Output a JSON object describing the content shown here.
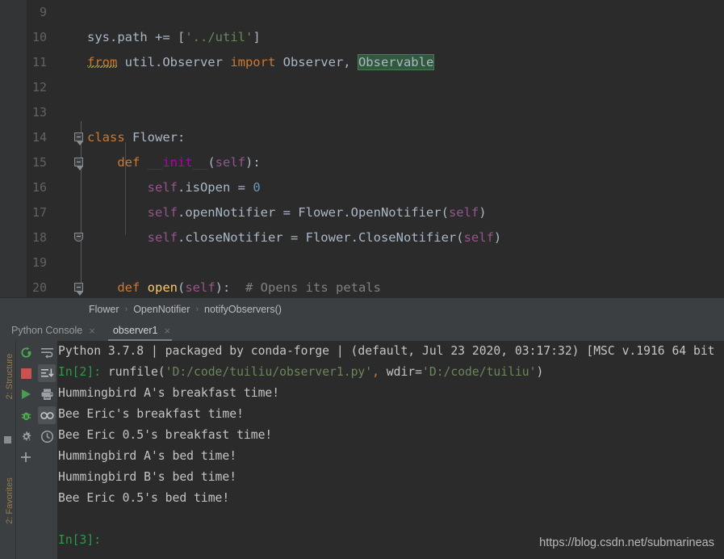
{
  "editor": {
    "first_visible_line": 9,
    "lines": [
      {
        "no": 9,
        "tokens": []
      },
      {
        "no": 10,
        "tokens": [
          {
            "t": "sys.path ",
            "c": "ident"
          },
          {
            "t": "+= ",
            "c": "op"
          },
          {
            "t": "[",
            "c": "ident"
          },
          {
            "t": "'../util'",
            "c": "str"
          },
          {
            "t": "]",
            "c": "ident"
          }
        ]
      },
      {
        "no": 11,
        "tokens": [
          {
            "t": "from",
            "c": "kw squiggle"
          },
          {
            "t": " util.Observer ",
            "c": "ident"
          },
          {
            "t": "import",
            "c": "kw"
          },
          {
            "t": " Observer, ",
            "c": "ident"
          },
          {
            "t": "Observable",
            "c": "hl-found"
          }
        ]
      },
      {
        "no": 12,
        "tokens": []
      },
      {
        "no": 13,
        "tokens": []
      },
      {
        "no": 14,
        "tokens": [
          {
            "t": "class",
            "c": "kw"
          },
          {
            "t": " Flower:",
            "c": "ident"
          }
        ]
      },
      {
        "no": 15,
        "tokens": [
          {
            "t": "    ",
            "c": "ident"
          },
          {
            "t": "def",
            "c": "kw-def"
          },
          {
            "t": " ",
            "c": "ident"
          },
          {
            "t": "__init__",
            "c": "magic"
          },
          {
            "t": "(",
            "c": "ident"
          },
          {
            "t": "self",
            "c": "self"
          },
          {
            "t": "):",
            "c": "ident"
          }
        ]
      },
      {
        "no": 16,
        "tokens": [
          {
            "t": "        ",
            "c": "ident"
          },
          {
            "t": "self",
            "c": "self"
          },
          {
            "t": ".isOpen = ",
            "c": "ident"
          },
          {
            "t": "0",
            "c": "num"
          }
        ]
      },
      {
        "no": 17,
        "tokens": [
          {
            "t": "        ",
            "c": "ident"
          },
          {
            "t": "self",
            "c": "self"
          },
          {
            "t": ".openNotifier = Flower.OpenNotifier(",
            "c": "ident"
          },
          {
            "t": "self",
            "c": "self"
          },
          {
            "t": ")",
            "c": "ident"
          }
        ]
      },
      {
        "no": 18,
        "tokens": [
          {
            "t": "        ",
            "c": "ident"
          },
          {
            "t": "self",
            "c": "self"
          },
          {
            "t": ".closeNotifier = Flower.CloseNotifier(",
            "c": "ident"
          },
          {
            "t": "self",
            "c": "self"
          },
          {
            "t": ")",
            "c": "ident"
          }
        ]
      },
      {
        "no": 19,
        "tokens": []
      },
      {
        "no": 20,
        "tokens": [
          {
            "t": "    ",
            "c": "ident"
          },
          {
            "t": "def",
            "c": "kw-def"
          },
          {
            "t": " ",
            "c": "ident"
          },
          {
            "t": "open",
            "c": "fn"
          },
          {
            "t": "(",
            "c": "ident"
          },
          {
            "t": "self",
            "c": "self"
          },
          {
            "t": "):  ",
            "c": "ident"
          },
          {
            "t": "# Opens its petals",
            "c": "comment"
          }
        ]
      }
    ],
    "highlight_color": "#32593d",
    "search_match_text": "Observable"
  },
  "breadcrumb": {
    "separator": "›",
    "items": [
      "Flower",
      "OpenNotifier",
      "notifyObservers()"
    ]
  },
  "tabs": {
    "close_glyph": "×",
    "items": [
      {
        "label": "Python Console",
        "active": false
      },
      {
        "label": "observer1",
        "active": true
      }
    ]
  },
  "rail": {
    "structure_label": "2: Structure",
    "favorites_label": "2: Favorites"
  },
  "run_toolbar": {
    "items": [
      {
        "name": "rerun-icon",
        "title": "Rerun"
      },
      {
        "name": "stop-icon",
        "title": "Stop"
      },
      {
        "name": "run-icon",
        "title": "Run"
      },
      {
        "name": "debug-icon",
        "title": "Debug"
      },
      {
        "name": "settings-icon",
        "title": "Settings"
      },
      {
        "name": "plus-icon",
        "title": "New"
      }
    ]
  },
  "console_toolbar": {
    "items": [
      {
        "name": "soft-wrap-icon",
        "selected": false
      },
      {
        "name": "scroll-to-end-icon",
        "selected": true
      },
      {
        "name": "print-icon",
        "selected": false
      },
      {
        "name": "infinity-icon",
        "selected": true
      },
      {
        "name": "history-clock-icon",
        "selected": false
      }
    ]
  },
  "console": {
    "lines": [
      {
        "segs": [
          {
            "t": "Python 3.7.8 | packaged by conda-forge | (default, Jul 23 2020, 03:17:32) [MSC v.1916 64 bit",
            "c": "c-txt"
          }
        ]
      },
      {
        "segs": [
          {
            "t": "In[2]: ",
            "c": "c-prompt"
          },
          {
            "t": "runfile(",
            "c": "c-txt"
          },
          {
            "t": "'D:/code/tuiliu/observer1.py'",
            "c": "c-str"
          },
          {
            "t": ",",
            "c": "c-op"
          },
          {
            "t": " wdir=",
            "c": "c-txt"
          },
          {
            "t": "'D:/code/tuiliu'",
            "c": "c-str"
          },
          {
            "t": ")",
            "c": "c-txt"
          }
        ]
      },
      {
        "segs": [
          {
            "t": "Hummingbird A's breakfast time!",
            "c": "c-txt"
          }
        ]
      },
      {
        "segs": [
          {
            "t": "Bee Eric's breakfast time!",
            "c": "c-txt"
          }
        ]
      },
      {
        "segs": [
          {
            "t": "Bee Eric 0.5's breakfast time!",
            "c": "c-txt"
          }
        ]
      },
      {
        "segs": [
          {
            "t": "Hummingbird A's bed time!",
            "c": "c-txt"
          }
        ]
      },
      {
        "segs": [
          {
            "t": "Hummingbird B's bed time!",
            "c": "c-txt"
          }
        ]
      },
      {
        "segs": [
          {
            "t": "Bee Eric 0.5's bed time!",
            "c": "c-txt"
          }
        ]
      },
      {
        "segs": []
      },
      {
        "segs": [
          {
            "t": "In[3]:",
            "c": "c-prompt"
          }
        ]
      }
    ]
  },
  "watermark": {
    "text": "https://blog.csdn.net/submarineas"
  },
  "colors": {
    "editor_bg": "#2b2b2b",
    "panel_bg": "#3c3f41",
    "gutter_bg": "#313335",
    "keyword": "#cc7832",
    "string": "#6a8759",
    "number": "#6897bb",
    "self": "#94558d",
    "function": "#ffc66d",
    "magic": "#b200b2",
    "comment": "#808080",
    "default_text": "#a9b7c6",
    "prompt_green": "#2e9b47",
    "found_highlight": "#32593d"
  }
}
